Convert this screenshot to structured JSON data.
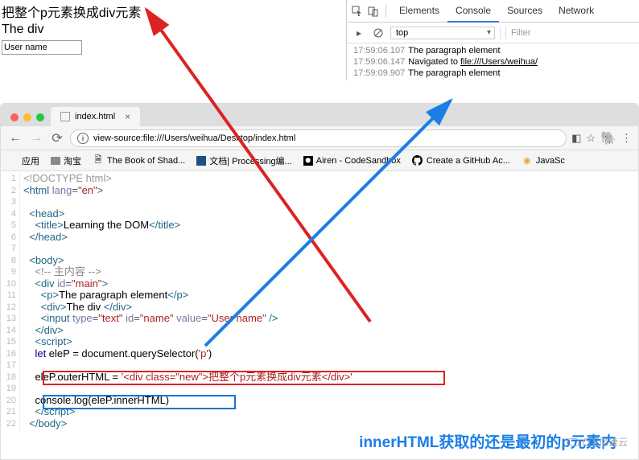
{
  "render": {
    "heading": "把整个p元素换成div元素",
    "text": "The div",
    "input_value": "User name"
  },
  "devtools": {
    "tabs": [
      "Elements",
      "Console",
      "Sources",
      "Network"
    ],
    "active_tab": "Console",
    "context": "top",
    "filter_placeholder": "Filter",
    "console": [
      {
        "ts": "17:59:06.107",
        "msg": "The paragraph element"
      },
      {
        "ts": "17:59:06.147",
        "msg": "Navigated to ",
        "link": "file:///Users/weihua/"
      },
      {
        "ts": "17:59:09.907",
        "msg": "The paragraph element"
      }
    ]
  },
  "browser": {
    "tab_title": "index.html",
    "url": "view-source:file:///Users/weihua/Desktop/index.html",
    "bookmarks": {
      "apps": "应用",
      "items": [
        "淘宝",
        "The Book of Shad...",
        "文档| Processing编...",
        "Airen - CodeSandbox",
        "Create a GitHub Ac...",
        "JavaSc"
      ]
    }
  },
  "source": {
    "lines": [
      {
        "n": 1,
        "html": "<span class='doctype'>&lt;!DOCTYPE html&gt;</span>"
      },
      {
        "n": 2,
        "html": "<span class='tag'>&lt;html</span> <span class='an'>lang</span><span class='eq'>=</span><span class='av'>\"en\"</span><span class='tag'>&gt;</span>"
      },
      {
        "n": 3,
        "html": ""
      },
      {
        "n": 4,
        "html": "  <span class='tag'>&lt;head&gt;</span>"
      },
      {
        "n": 5,
        "html": "    <span class='tag'>&lt;title&gt;</span><span class='txt'>Learning the DOM</span><span class='tag'>&lt;/title&gt;</span>"
      },
      {
        "n": 6,
        "html": "  <span class='tag'>&lt;/head&gt;</span>"
      },
      {
        "n": 7,
        "html": ""
      },
      {
        "n": 8,
        "html": "  <span class='tag'>&lt;body&gt;</span>"
      },
      {
        "n": 9,
        "html": "    <span class='cmt'>&lt;!-- 主内容 --&gt;</span>"
      },
      {
        "n": 10,
        "html": "    <span class='tag'>&lt;div</span> <span class='an'>id</span><span class='eq'>=</span><span class='av'>\"main\"</span><span class='tag'>&gt;</span>"
      },
      {
        "n": 11,
        "html": "      <span class='tag'>&lt;p&gt;</span><span class='txt'>The paragraph element</span><span class='tag'>&lt;/p&gt;</span>"
      },
      {
        "n": 12,
        "html": "      <span class='tag'>&lt;div&gt;</span><span class='txt'>The div </span><span class='tag'>&lt;/div&gt;</span>"
      },
      {
        "n": 13,
        "html": "      <span class='tag'>&lt;input</span> <span class='an'>type</span><span class='eq'>=</span><span class='av'>\"text\"</span> <span class='an'>id</span><span class='eq'>=</span><span class='av'>\"name\"</span> <span class='an'>value</span><span class='eq'>=</span><span class='av'>\"User name\"</span> <span class='tag'>/&gt;</span>"
      },
      {
        "n": 14,
        "html": "    <span class='tag'>&lt;/div&gt;</span>"
      },
      {
        "n": 15,
        "html": "    <span class='tag'>&lt;script&gt;</span>"
      },
      {
        "n": 16,
        "html": "    <span class='kw'>let</span> eleP = document.querySelector(<span class='av'>'p'</span>)"
      },
      {
        "n": 17,
        "html": ""
      },
      {
        "n": 18,
        "html": "    eleP.outerHTML = <span class='av'>'&lt;div class=\"new\"&gt;把整个p元素换成div元素&lt;/div&gt;'</span>"
      },
      {
        "n": 19,
        "html": ""
      },
      {
        "n": 20,
        "html": "    console.log(eleP.innerHTML)"
      },
      {
        "n": 21,
        "html": "    <span class='tag'>&lt;/script&gt;</span>"
      },
      {
        "n": 22,
        "html": "  <span class='tag'>&lt;/body&gt;</span>"
      }
    ]
  },
  "annotation": "innerHTML获取的还是最初的p元素内",
  "watermark": "亿速云"
}
